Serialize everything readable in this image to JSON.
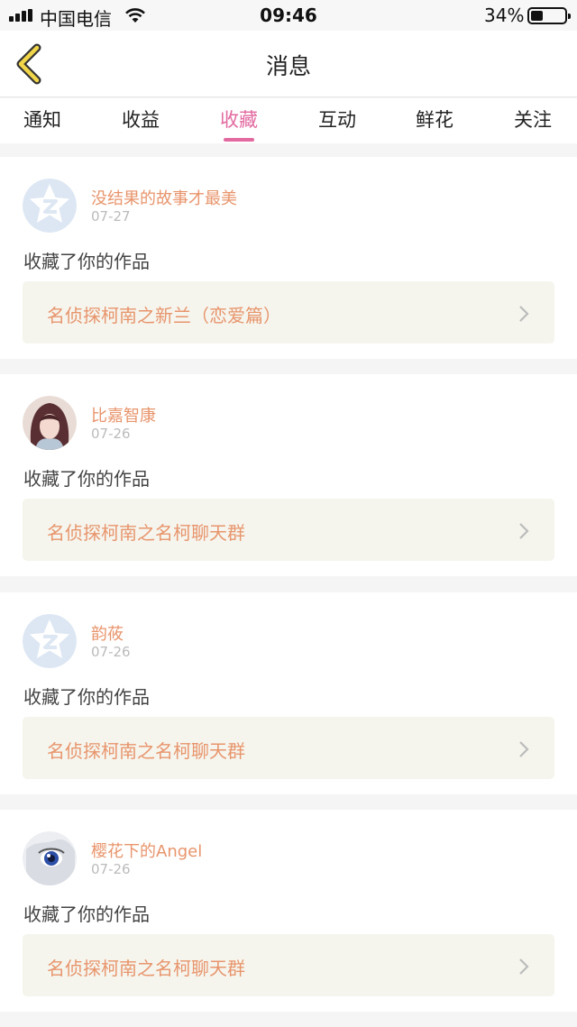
{
  "status": {
    "carrier": "中国电信",
    "time": "09:46",
    "battery": "34%"
  },
  "nav": {
    "title": "消息",
    "back_icon": "chevron-left-icon"
  },
  "tabs": [
    {
      "label": "通知",
      "active": false
    },
    {
      "label": "收益",
      "active": false
    },
    {
      "label": "收藏",
      "active": true
    },
    {
      "label": "互动",
      "active": false
    },
    {
      "label": "鲜花",
      "active": false
    },
    {
      "label": "关注",
      "active": false
    }
  ],
  "colors": {
    "accent": "#e26aa0",
    "name": "#e8956c",
    "link_bg": "#f5f5ee"
  },
  "messages": [
    {
      "user": "没结果的故事才最美",
      "date": "07-27",
      "action": "收藏了你的作品",
      "work": "名侦探柯南之新兰（恋爱篇）",
      "avatar": "default-star-avatar"
    },
    {
      "user": "比嘉智康",
      "date": "07-26",
      "action": "收藏了你的作品",
      "work": "名侦探柯南之名柯聊天群",
      "avatar": "anime-girl-avatar"
    },
    {
      "user": "韵莜",
      "date": "07-26",
      "action": "收藏了你的作品",
      "work": "名侦探柯南之名柯聊天群",
      "avatar": "default-star-avatar"
    },
    {
      "user": "樱花下的Angel",
      "date": "07-26",
      "action": "收藏了你的作品",
      "work": "名侦探柯南之名柯聊天群",
      "avatar": "anime-eye-avatar"
    }
  ]
}
